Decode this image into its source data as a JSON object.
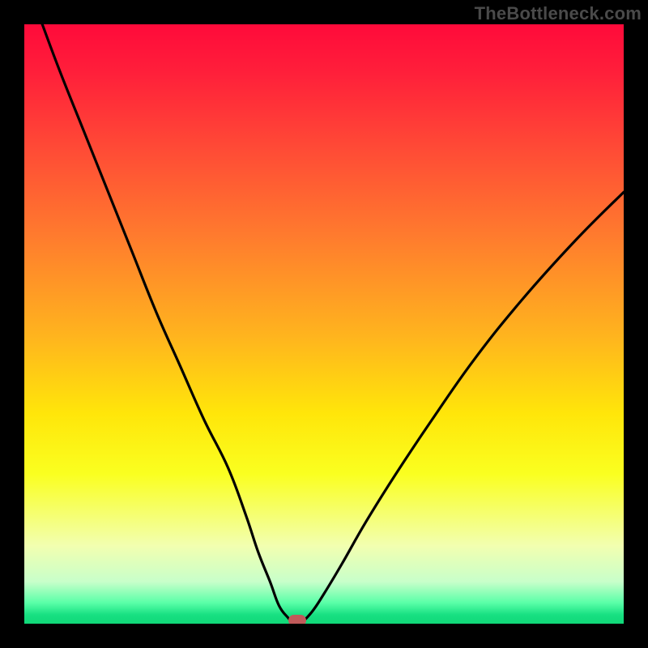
{
  "watermark": "TheBottleneck.com",
  "colors": {
    "background": "#000000",
    "curve_stroke": "#000000",
    "marker_fill": "#c05a5a"
  },
  "chart_data": {
    "type": "line",
    "title": "",
    "xlabel": "",
    "ylabel": "",
    "xlim": [
      0,
      100
    ],
    "ylim": [
      0,
      100
    ],
    "grid": false,
    "series": [
      {
        "name": "bottleneck-curve",
        "x": [
          3,
          6,
          10,
          14,
          18,
          22,
          26,
          30,
          34,
          37,
          39,
          41,
          42.5,
          44,
          45,
          46,
          48,
          50,
          53,
          57,
          62,
          68,
          75,
          83,
          92,
          100
        ],
        "values": [
          100,
          92,
          82,
          72,
          62,
          52,
          43,
          34,
          26,
          18,
          12,
          7,
          3,
          1,
          0,
          0,
          2,
          5,
          10,
          17,
          25,
          34,
          44,
          54,
          64,
          72
        ]
      }
    ],
    "marker": {
      "x": 45.5,
      "y": 0.5
    },
    "gradient_stops": [
      {
        "pct": 0,
        "color": "#ff0a3a"
      },
      {
        "pct": 35,
        "color": "#ff7a2e"
      },
      {
        "pct": 65,
        "color": "#ffe60a"
      },
      {
        "pct": 93,
        "color": "#c8ffca"
      },
      {
        "pct": 100,
        "color": "#10d878"
      }
    ]
  }
}
